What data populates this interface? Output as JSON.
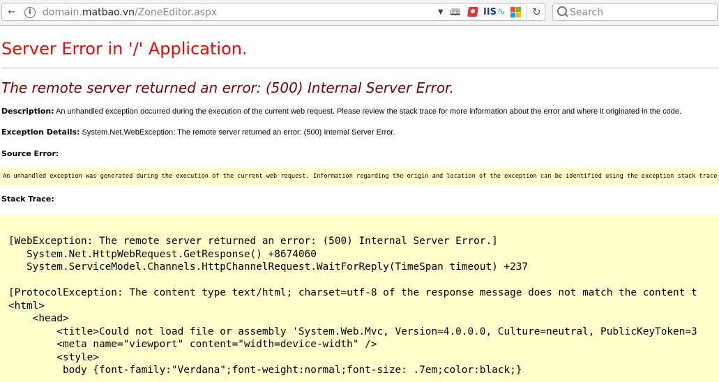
{
  "browser": {
    "url_prefix": "domain.",
    "url_host": "matbao.vn",
    "url_path": "/ZoneEditor.aspx",
    "extension_iis_label": "IIS",
    "search_placeholder": "Search"
  },
  "page": {
    "title": "Server Error in '/' Application.",
    "subtitle": "The remote server returned an error: (500) Internal Server Error.",
    "description_label": "Description:",
    "description_text": "An unhandled exception occurred during the execution of the current web request. Please review the stack trace for more information about the error and where it originated in the code.",
    "exception_label": "Exception Details:",
    "exception_text": "System.Net.WebException: The remote server returned an error: (500) Internal Server Error.",
    "source_error_label": "Source Error:",
    "source_error_text": "An unhandled exception was generated during the execution of the current web request. Information regarding the origin and location of the exception can be identified using the exception stack trace below.",
    "stack_trace_label": "Stack Trace:",
    "stack_trace_lines": [
      "[WebException: The remote server returned an error: (500) Internal Server Error.]",
      "   System.Net.HttpWebRequest.GetResponse() +8674060",
      "   System.ServiceModel.Channels.HttpChannelRequest.WaitForReply(TimeSpan timeout) +237",
      "",
      "[ProtocolException: The content type text/html; charset=utf-8 of the response message does not match the content t",
      "<html>",
      "    <head>",
      "        <title>Could not load file or assembly 'System.Web.Mvc, Version=4.0.0.0, Culture=neutral, PublicKeyToken=3",
      "        <meta name=\"viewport\" content=\"width=device-width\" />",
      "        <style>",
      "         body {font-family:\"Verdana\";font-weight:normal;font-size: .7em;color:black;}"
    ]
  }
}
